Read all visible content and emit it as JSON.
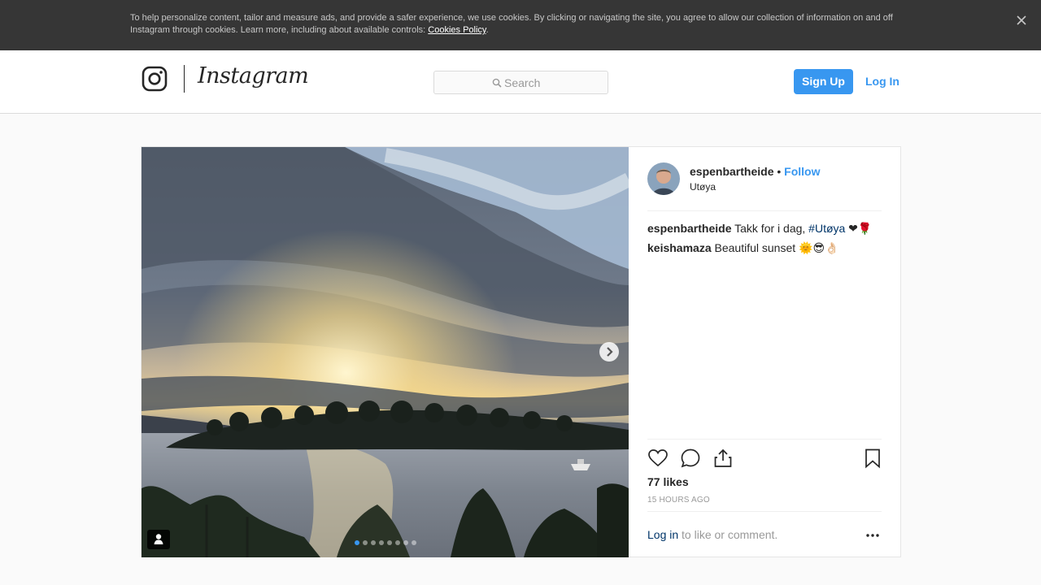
{
  "cookie_banner": {
    "text": "To help personalize content, tailor and measure ads, and provide a safer experience, we use cookies. By clicking or navigating the site, you agree to allow our collection of information on and off Instagram through cookies. Learn more, including about available controls: ",
    "link_label": "Cookies Policy",
    "trailing": "."
  },
  "header": {
    "wordmark": "Instagram",
    "search_placeholder": "Search",
    "signup_label": "Sign Up",
    "login_label": "Log In"
  },
  "post": {
    "username": "espenbartheide",
    "separator": "•",
    "follow_label": "Follow",
    "location": "Utøya",
    "comments": [
      {
        "user": "espenbartheide",
        "text": "Takk for i dag, ",
        "hashtag": "#Utøya",
        "tail": " ❤🌹"
      },
      {
        "user": "keishamaza",
        "text": "Beautiful sunset 🌞😎👌🏻"
      }
    ],
    "likes": "77 likes",
    "time": "15 HOURS AGO",
    "login_link": "Log in",
    "login_tail": " to like or comment.",
    "carousel": {
      "current": 1,
      "total": 8
    }
  },
  "colors": {
    "accent": "#3897f0",
    "banner_bg": "#363636",
    "hashtag": "#003569"
  },
  "icons": [
    "close-icon",
    "instagram-glyph-icon",
    "search-icon",
    "chevron-right-icon",
    "user-tag-icon",
    "heart-icon",
    "comment-icon",
    "share-icon",
    "bookmark-icon",
    "more-icon"
  ]
}
